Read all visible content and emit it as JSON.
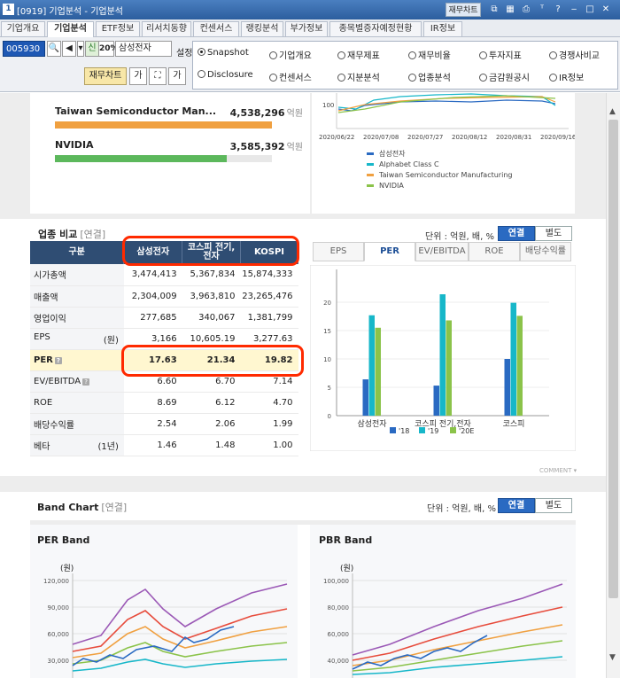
{
  "window": {
    "number": "1",
    "title": "[0919] 기업분석 - 기업분석",
    "fin_chart_btn": "재무차트",
    "icons": [
      "restore-icon",
      "grid-icon",
      "print-icon",
      "font-size-icon",
      "help-icon",
      "minimize-icon",
      "maximize-icon",
      "close-icon"
    ],
    "icon_glyphs": [
      "⧉",
      "▦",
      "⎙",
      "ᵀ",
      "?",
      "‒",
      "□",
      "✕"
    ]
  },
  "tabs": [
    "기업개요",
    "기업분석",
    "ETF정보",
    "리서치동향",
    "컨센서스",
    "랭킹분석",
    "부가정보",
    "종목별증자예정현황",
    "IR정보"
  ],
  "active_tab": "기업분석",
  "controls": {
    "code": "005930",
    "credit_badge": "신",
    "percent_badge": "20%",
    "stock_name": "삼성전자",
    "settings_label": "설정",
    "fin_chart_button": "재무차트"
  },
  "radio_options": [
    {
      "label": "Snapshot",
      "selected": true
    },
    {
      "label": "기업개요",
      "selected": false
    },
    {
      "label": "재무제표",
      "selected": false
    },
    {
      "label": "재무비율",
      "selected": false
    },
    {
      "label": "투자지표",
      "selected": false
    },
    {
      "label": "경쟁사비교",
      "selected": false
    },
    {
      "label": "Disclosure",
      "selected": false
    },
    {
      "label": "컨센서스",
      "selected": false
    },
    {
      "label": "지분분석",
      "selected": false
    },
    {
      "label": "업종분석",
      "selected": false
    },
    {
      "label": "금감원공시",
      "selected": false
    },
    {
      "label": "IR정보",
      "selected": false
    }
  ],
  "market_cap_bars": {
    "unit": "억원",
    "items": [
      {
        "name": "Taiwan Semiconductor Man...",
        "value": "4,538,296",
        "ratio": 1.0,
        "color": "#f0a040"
      },
      {
        "name": "NVIDIA",
        "value": "3,585,392",
        "ratio": 0.79,
        "color": "#5cb85c"
      }
    ]
  },
  "price_chart": {
    "y_tick": "100",
    "x_ticks": [
      "2020/06/22",
      "2020/07/08",
      "2020/07/27",
      "2020/08/12",
      "2020/08/31",
      "2020/09/16"
    ],
    "legend": [
      {
        "label": "삼성전자",
        "color": "#2a6ac2"
      },
      {
        "label": "Alphabet Class C",
        "color": "#17b7c9"
      },
      {
        "label": "Taiwan Semiconductor Manufacturing",
        "color": "#f0a040"
      },
      {
        "label": "NVIDIA",
        "color": "#8bc34a"
      }
    ]
  },
  "industry_comparison": {
    "title": "업종 비교",
    "subtitle": "[연결]",
    "unit_label": "단위 : 억원, 배, %",
    "toggle_on": "연결",
    "toggle_off": "별도",
    "headers": [
      "구분",
      "삼성전자",
      "코스피 전기,\n전자",
      "KOSPI"
    ],
    "rows": [
      {
        "label": "시가총액",
        "unit": "",
        "info": false,
        "values": [
          "3,474,413",
          "5,367,834",
          "15,874,333"
        ]
      },
      {
        "label": "매출액",
        "unit": "",
        "info": false,
        "values": [
          "2,304,009",
          "3,963,810",
          "23,265,476"
        ]
      },
      {
        "label": "영업이익",
        "unit": "",
        "info": false,
        "values": [
          "277,685",
          "340,067",
          "1,381,799"
        ]
      },
      {
        "label": "EPS",
        "unit": "(원)",
        "info": false,
        "values": [
          "3,166",
          "10,605.19",
          "3,277.63"
        ]
      },
      {
        "label": "PER",
        "unit": "",
        "info": true,
        "values": [
          "17.63",
          "21.34",
          "19.82"
        ],
        "highlight": true
      },
      {
        "label": "EV/EBITDA",
        "unit": "",
        "info": true,
        "values": [
          "6.60",
          "6.70",
          "7.14"
        ]
      },
      {
        "label": "ROE",
        "unit": "",
        "info": false,
        "values": [
          "8.69",
          "6.12",
          "4.70"
        ]
      },
      {
        "label": "배당수익률",
        "unit": "",
        "info": false,
        "values": [
          "2.54",
          "2.06",
          "1.99"
        ]
      },
      {
        "label": "베타",
        "unit": "(1년)",
        "info": false,
        "values": [
          "1.46",
          "1.48",
          "1.00"
        ]
      }
    ],
    "chart_tabs": [
      "EPS",
      "PER",
      "EV/EBITDA",
      "ROE",
      "배당수익률"
    ],
    "active_chart_tab": "PER",
    "comment_label": "COMMENT ▾"
  },
  "chart_data": {
    "type": "bar",
    "categories": [
      "삼성전자",
      "코스피 전기,전자",
      "코스피"
    ],
    "series": [
      {
        "name": "'18",
        "color": "#2a6ac2",
        "values": [
          6.4,
          5.3,
          10.0
        ]
      },
      {
        "name": "'19",
        "color": "#17b7c9",
        "values": [
          17.7,
          21.4,
          19.9
        ]
      },
      {
        "name": "'20E",
        "color": "#8bc34a",
        "values": [
          15.5,
          16.8,
          17.6
        ]
      }
    ],
    "ylim": [
      0,
      25
    ],
    "yticks": [
      0,
      5,
      10,
      15,
      20
    ],
    "grid": true,
    "legend_position": "bottom"
  },
  "band_chart": {
    "title": "Band Chart",
    "subtitle": "[연결]",
    "unit_label": "단위 : 억원, 배, %",
    "toggle_on": "연결",
    "toggle_off": "별도",
    "per_band": {
      "title": "PER Band",
      "unit": "(원)",
      "yticks": [
        "120,000",
        "90,000",
        "60,000",
        "30,000"
      ]
    },
    "pbr_band": {
      "title": "PBR Band",
      "unit": "(원)",
      "yticks": [
        "100,000",
        "80,000",
        "60,000",
        "40,000"
      ]
    }
  }
}
